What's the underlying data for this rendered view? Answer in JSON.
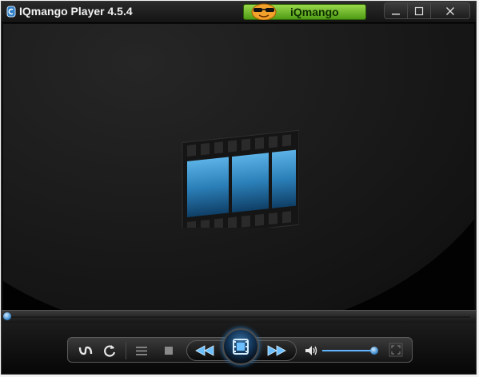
{
  "window": {
    "title": "IQmango Player 4.5.4"
  },
  "brand": {
    "label": "iQmango"
  },
  "colors": {
    "accent": "#2d7fc7",
    "brand_green": "#6fbf2a",
    "background": "#0b0b0b"
  },
  "titlebar_buttons": [
    "minimize-icon",
    "maximize-icon",
    "close-icon"
  ],
  "video": {
    "placeholder_icon": "film-strip-icon"
  },
  "seekbar": {
    "progress": 0.0
  },
  "controls": [
    {
      "name": "repeat-mode-button",
      "icon": "loop-icon"
    },
    {
      "name": "refresh-button",
      "icon": "refresh-icon"
    },
    {
      "name": "playlist-button",
      "icon": "list-icon"
    },
    {
      "name": "stop-button",
      "icon": "stop-icon"
    },
    {
      "name": "rewind-button",
      "icon": "rewind-icon"
    },
    {
      "name": "open-file-button",
      "icon": "film-icon"
    },
    {
      "name": "fast-forward-button",
      "icon": "fast-forward-icon"
    },
    {
      "name": "volume-button",
      "icon": "speaker-icon"
    },
    {
      "name": "fullscreen-button",
      "icon": "fullscreen-icon"
    }
  ],
  "volume": {
    "level": 1.0
  }
}
